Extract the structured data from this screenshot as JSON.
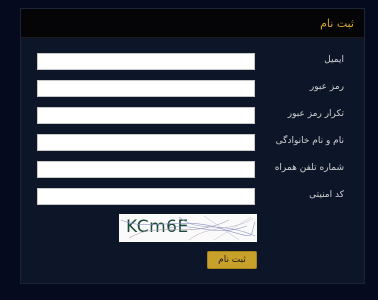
{
  "header": {
    "title": "ثبت نام"
  },
  "form": {
    "fields": [
      {
        "label": "ایمیل",
        "value": "",
        "placeholder": ""
      },
      {
        "label": "رمز عبور",
        "value": "",
        "placeholder": ""
      },
      {
        "label": "تکرار رمز عبور",
        "value": "",
        "placeholder": ""
      },
      {
        "label": "نام و نام خانوادگی",
        "value": "",
        "placeholder": ""
      },
      {
        "label": "شماره تلفن همراه",
        "value": "",
        "placeholder": ""
      },
      {
        "label": "کد امنیتی",
        "value": "",
        "placeholder": ""
      }
    ],
    "captcha_text": "KCm6E",
    "submit_label": "ثبت نام"
  },
  "colors": {
    "page_bg": "#050a1f",
    "panel_bg": "#0d1628",
    "header_bg": "#050507",
    "accent": "#d8a82a",
    "button_bg": "#c7a12a"
  }
}
